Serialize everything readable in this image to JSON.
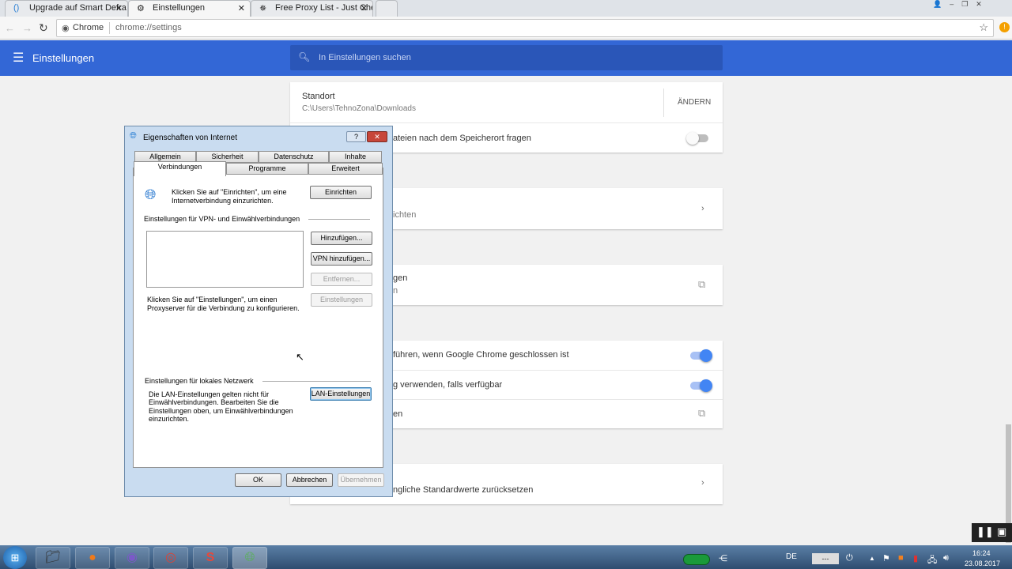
{
  "browser": {
    "tabs": [
      {
        "label": "Upgrade auf Smart Defra",
        "icon": "smart-defrag-icon"
      },
      {
        "label": "Einstellungen",
        "icon": "gear-icon",
        "active": true
      },
      {
        "label": "Free Proxy List - Just Che",
        "icon": "proxy-icon"
      }
    ],
    "omnibox": {
      "site": "Chrome",
      "url": "chrome://settings"
    }
  },
  "settings": {
    "title": "Einstellungen",
    "search_placeholder": "In Einstellungen suchen",
    "download": {
      "label": "Standort",
      "path": "C:\\Users\\TehnoZona\\Downloads",
      "change": "ÄNDERN",
      "ask": "ateien nach dem Speicherort fragen",
      "ask_on": false
    },
    "card2": "ichten",
    "card3": {
      "line1": "gen",
      "line2": "n"
    },
    "system": {
      "bg": "führen, wenn Google Chrome geschlossen ist",
      "bg_on": true,
      "hw": "g verwenden, falls verfügbar",
      "hw_on": true,
      "proxy": "en"
    },
    "reset": "ngliche Standardwerte zurücksetzen",
    "accent": "#3367d6"
  },
  "dialog": {
    "title": "Eigenschaften von Internet",
    "tabs_top": [
      "Allgemein",
      "Sicherheit",
      "Datenschutz",
      "Inhalte"
    ],
    "tabs_bottom": [
      "Verbindungen",
      "Programme",
      "Erweitert"
    ],
    "setup_text1": "Klicken Sie auf \"Einrichten\", um eine",
    "setup_text2": "Internetverbindung einzurichten.",
    "setup_btn": "Einrichten",
    "vpn_heading": "Einstellungen für VPN- und Einwählverbindungen",
    "add_btn": "Hinzufügen...",
    "vpn_btn": "VPN hinzufügen...",
    "remove_btn": "Entfernen...",
    "settings_btn": "Einstellungen",
    "proxy_text1": "Klicken Sie auf \"Einstellungen\", um einen",
    "proxy_text2": "Proxyserver für die Verbindung zu konfigurieren.",
    "lan_heading": "Einstellungen für lokales Netzwerk",
    "lan_text": [
      "Die LAN-Einstellungen gelten nicht für",
      "Einwählverbindungen. Bearbeiten Sie die",
      "Einstellungen oben, um Einwählverbindungen",
      "einzurichten."
    ],
    "lan_btn": "LAN-Einstellungen",
    "ok": "OK",
    "cancel": "Abbrechen",
    "apply": "Übernehmen"
  },
  "taskbar": {
    "lang": "DE",
    "battery": "---",
    "time": "16:24",
    "date": "23.08.2017"
  }
}
